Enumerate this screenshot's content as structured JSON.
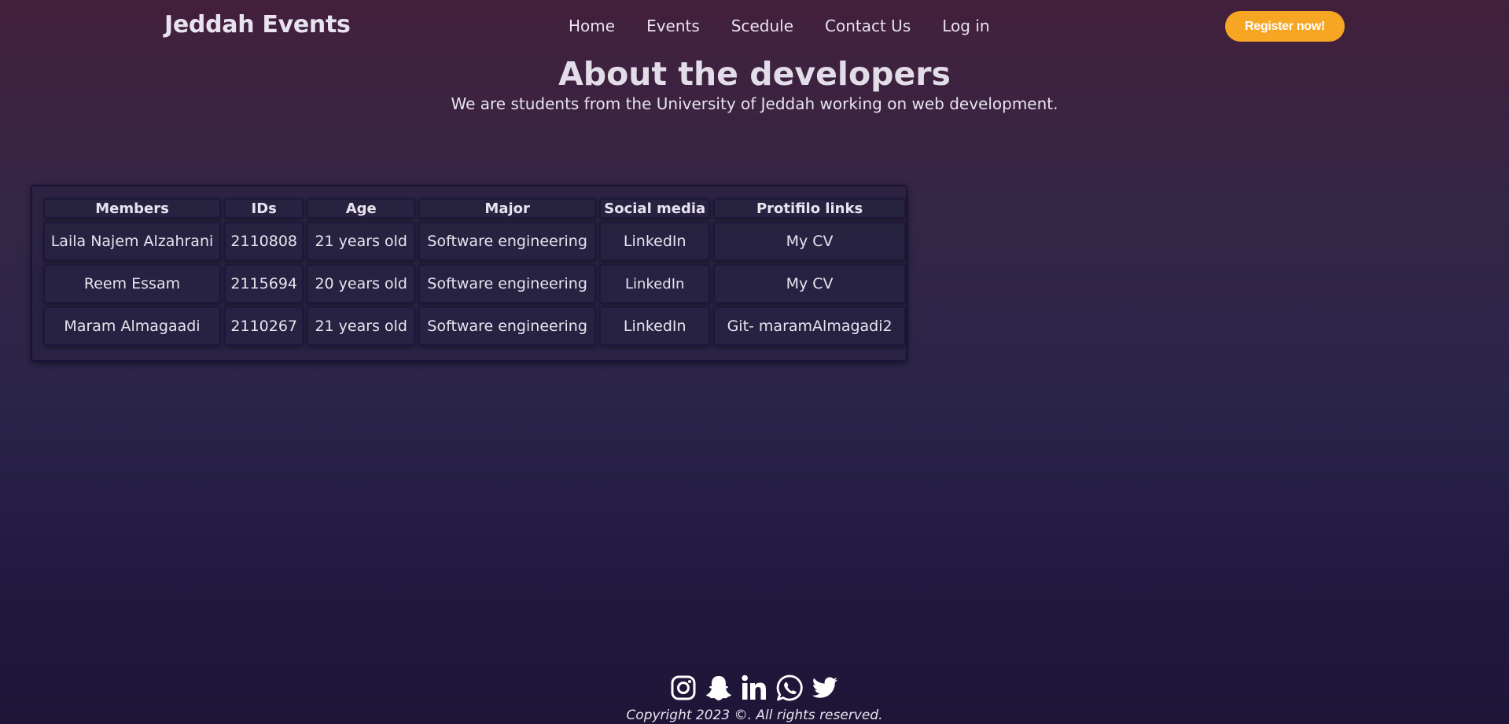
{
  "header": {
    "brand": "Jeddah Events",
    "nav": [
      "Home",
      "Events",
      "Scedule",
      "Contact Us",
      "Log in"
    ],
    "register_label": "Register now!"
  },
  "hero": {
    "title": "About the developers",
    "subtitle": "We are students from the University of Jeddah working on web development."
  },
  "table": {
    "headers": [
      "Members",
      "IDs",
      "Age",
      "Major",
      "Social media",
      "Protifilo links"
    ],
    "rows": [
      [
        "Laila Najem Alzahrani",
        "2110808",
        "21 years old",
        "Software engineering",
        "LinkedIn",
        "My CV"
      ],
      [
        "Reem Essam",
        "2115694",
        "20 years old",
        "Software engineering",
        "LinkedIn",
        "My CV"
      ],
      [
        "Maram Almagaadi",
        "2110267",
        "21 years old",
        "Software engineering",
        "LinkedIn",
        "Git- maramAlmagadi2"
      ]
    ]
  },
  "footer": {
    "icons": [
      "instagram-icon",
      "snapchat-icon",
      "linkedin-icon",
      "whatsapp-icon",
      "twitter-icon"
    ],
    "copyright": "Copyright 2023 ©. All rights reserved."
  },
  "colors": {
    "accent": "#f6a623",
    "background_top": "#43203c",
    "background_bottom": "#1e1537",
    "text": "#e8e3ee"
  }
}
